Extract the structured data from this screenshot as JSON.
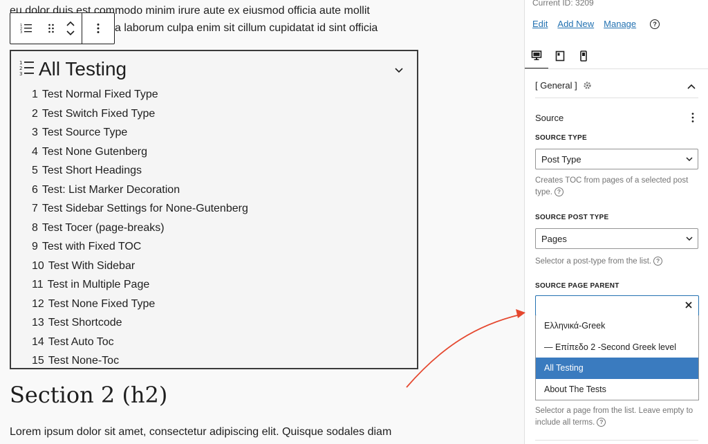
{
  "editor": {
    "para_top_line1": "eu dolor duis est commodo minim irure aute ex eiusmod officia aute mollit",
    "para_top_line2": "a laborum culpa enim sit cillum cupidatat id sint officia",
    "toc": {
      "title": "All Testing",
      "items": [
        {
          "num": "1",
          "label": "Test Normal Fixed Type"
        },
        {
          "num": "2",
          "label": "Test Switch Fixed Type"
        },
        {
          "num": "3",
          "label": "Test Source Type"
        },
        {
          "num": "4",
          "label": "Test None Gutenberg"
        },
        {
          "num": "5",
          "label": "Test Short Headings"
        },
        {
          "num": "6",
          "label": "Test: List Marker Decoration"
        },
        {
          "num": "7",
          "label": "Test Sidebar Settings for None-Gutenberg"
        },
        {
          "num": "8",
          "label": "Test Tocer (page-breaks)"
        },
        {
          "num": "9",
          "label": "Test with Fixed TOC"
        },
        {
          "num": "10",
          "label": "Test With Sidebar"
        },
        {
          "num": "11",
          "label": "Test in Multiple Page"
        },
        {
          "num": "12",
          "label": "Test None Fixed Type"
        },
        {
          "num": "13",
          "label": "Test Shortcode"
        },
        {
          "num": "14",
          "label": "Test Auto Toc"
        },
        {
          "num": "15",
          "label": "Test None-Toc"
        }
      ]
    },
    "section_heading": "Section 2 (h2)",
    "para_bottom": "Lorem ipsum dolor sit amet, consectetur adipiscing elit. Quisque sodales diam"
  },
  "sidebar": {
    "current_id": "Current ID: 3209",
    "links": {
      "edit": "Edit",
      "add_new": "Add New",
      "manage": "Manage"
    },
    "help_glyph": "?",
    "panel_title": "[ General ]",
    "source_title": "Source",
    "source_type": {
      "label": "SOURCE TYPE",
      "value": "Post Type",
      "help": "Creates TOC from pages of a selected post type."
    },
    "source_post_type": {
      "label": "SOURCE POST TYPE",
      "value": "Pages",
      "help": "Selector a post-type from the list."
    },
    "source_page_parent": {
      "label": "SOURCE PAGE PARENT",
      "value": "",
      "options": [
        {
          "label": "Ελληνικά-Greek",
          "selected": false
        },
        {
          "label": "— Επίπεδο 2 -Second Greek level",
          "selected": false
        },
        {
          "label": "All Testing",
          "selected": true
        },
        {
          "label": "About The Tests",
          "selected": false
        }
      ],
      "help": "Selector a page from the list. Leave empty to include all terms."
    }
  },
  "colors": {
    "accent": "#2271b1",
    "selected_option": "#3a7bbf",
    "annotation_arrow": "#e5482f"
  },
  "icons": {
    "block_type": "numbered-list-icon",
    "drag": "drag-handle-icon",
    "move": "move-up-down-icon",
    "options": "more-vertical-icon",
    "settings": "gear-icon",
    "devices": [
      "desktop-icon",
      "tablet-icon",
      "mobile-icon"
    ]
  }
}
